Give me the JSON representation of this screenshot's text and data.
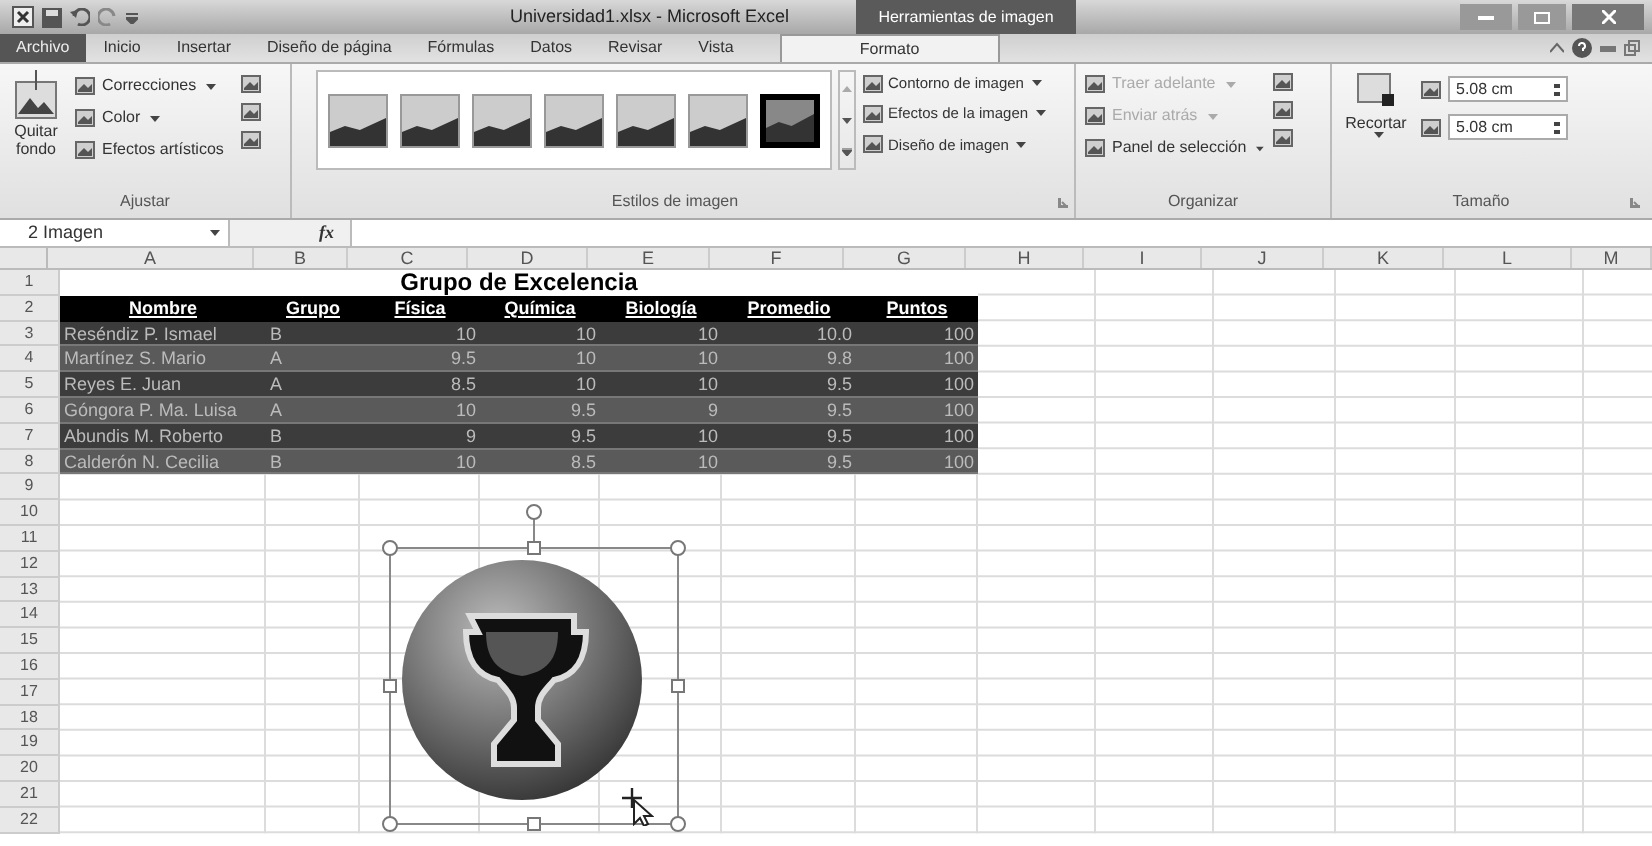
{
  "title_bar": {
    "title": "Universidad1.xlsx - Microsoft Excel",
    "context_title": "Herramientas de imagen"
  },
  "tabs": [
    {
      "label": "Archivo",
      "kind": "file",
      "selected": false
    },
    {
      "label": "Inicio",
      "kind": "tab",
      "selected": false
    },
    {
      "label": "Insertar",
      "kind": "tab",
      "selected": false
    },
    {
      "label": "Diseño de página",
      "kind": "tab",
      "selected": false
    },
    {
      "label": "Fórmulas",
      "kind": "tab",
      "selected": false
    },
    {
      "label": "Datos",
      "kind": "tab",
      "selected": false
    },
    {
      "label": "Revisar",
      "kind": "tab",
      "selected": false
    },
    {
      "label": "Vista",
      "kind": "tab",
      "selected": false
    },
    {
      "label": "Formato",
      "kind": "context",
      "selected": true
    }
  ],
  "ajustar": {
    "label": "Ajustar",
    "big_button": "Quitar fondo",
    "commands": [
      {
        "label": "Correcciones"
      },
      {
        "label": "Color"
      },
      {
        "label": "Efectos artísticos"
      }
    ]
  },
  "estilos": {
    "label": "Estilos de imagen",
    "thumbnails": [
      {
        "selected": false
      },
      {
        "selected": false
      },
      {
        "selected": false
      },
      {
        "selected": false
      },
      {
        "selected": false
      },
      {
        "selected": false
      },
      {
        "selected": true
      }
    ],
    "commands": [
      {
        "label": "Contorno de imagen"
      },
      {
        "label": "Efectos de la imagen"
      },
      {
        "label": "Diseño de imagen"
      }
    ]
  },
  "organizar": {
    "label": "Organizar",
    "commands": [
      {
        "label": "Traer adelante",
        "disabled": true
      },
      {
        "label": "Enviar atrás",
        "disabled": true
      },
      {
        "label": "Panel de selección",
        "disabled": false
      }
    ]
  },
  "tamano": {
    "label": "Tamaño",
    "big_button": "Recortar",
    "height": "5.08 cm",
    "width": "5.08 cm"
  },
  "formula_bar": {
    "name_box": "2 Imagen",
    "function_button": "fx"
  },
  "sheet": {
    "columns": [
      "A",
      "B",
      "C",
      "D",
      "E",
      "F",
      "G",
      "H",
      "I",
      "J",
      "K",
      "L",
      "M"
    ],
    "row_numbers": [
      "1",
      "2",
      "3",
      "4",
      "5",
      "6",
      "7",
      "8",
      "9",
      "10",
      "11",
      "12",
      "13",
      "14",
      "15",
      "16",
      "17",
      "18",
      "19",
      "20",
      "21",
      "22"
    ],
    "title": "Grupo de Excelencia",
    "header": [
      "Nombre",
      "Grupo",
      "Física",
      "Química",
      "Biología",
      "Promedio",
      "Puntos"
    ],
    "rows": [
      [
        "Reséndiz P. Ismael",
        "B",
        "10",
        "10",
        "10",
        "10.0",
        "100"
      ],
      [
        "Martínez S. Mario",
        "A",
        "9.5",
        "10",
        "10",
        "9.8",
        "100"
      ],
      [
        "Reyes E. Juan",
        "A",
        "8.5",
        "10",
        "10",
        "9.5",
        "100"
      ],
      [
        "Góngora P. Ma. Luisa",
        "A",
        "10",
        "9.5",
        "9",
        "9.5",
        "100"
      ],
      [
        "Abundis M. Roberto",
        "B",
        "9",
        "9.5",
        "10",
        "9.5",
        "100"
      ],
      [
        "Calderón N. Cecilia",
        "B",
        "10",
        "8.5",
        "10",
        "9.5",
        "100"
      ]
    ]
  }
}
